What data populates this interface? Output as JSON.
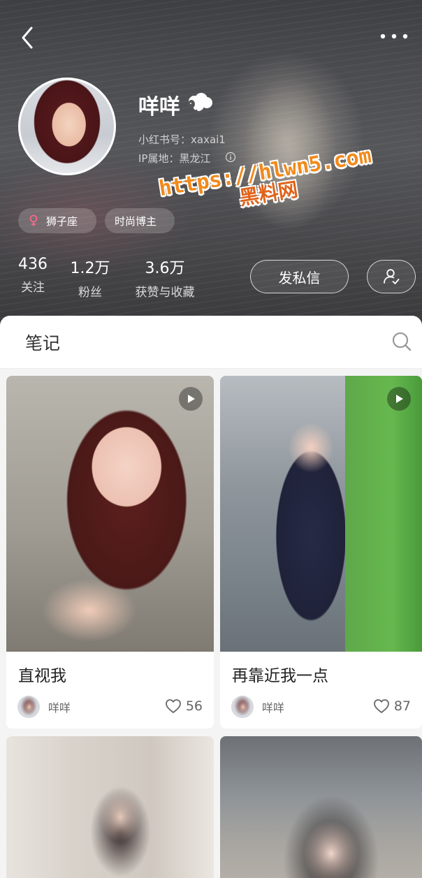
{
  "profile": {
    "nickname": "咩咩",
    "red_id": "小红书号：xaxai1",
    "ip_location": "IP属地：黑龙江",
    "tags": {
      "zodiac": "狮子座",
      "blogger": "时尚博主"
    },
    "stats": {
      "following_value": "436",
      "following_label": "关注",
      "fans_value": "1.2万",
      "fans_label": "粉丝",
      "likes_value": "3.6万",
      "likes_label": "获赞与收藏"
    },
    "message_button": "发私信"
  },
  "watermark": {
    "url": "https://hlwn5.com",
    "name": "黑料网"
  },
  "tabs": {
    "notes": "笔记"
  },
  "notes": [
    {
      "title": "直视我",
      "author": "咩咩",
      "likes": "56",
      "is_video": true
    },
    {
      "title": "再靠近我一点",
      "author": "咩咩",
      "likes": "87",
      "is_video": true
    }
  ],
  "icons": {
    "back": "chevron-left-icon",
    "more": "more-dots-icon",
    "sheep": "sheep-emoji-icon",
    "info": "info-icon",
    "female": "female-icon",
    "follow": "user-check-icon",
    "search": "search-icon",
    "play": "play-icon",
    "heart": "heart-outline-icon"
  },
  "colors": {
    "watermark_orange": "#f28a1c",
    "header_bg": "#4a4b4f",
    "page_bg": "#f4f4f4"
  }
}
